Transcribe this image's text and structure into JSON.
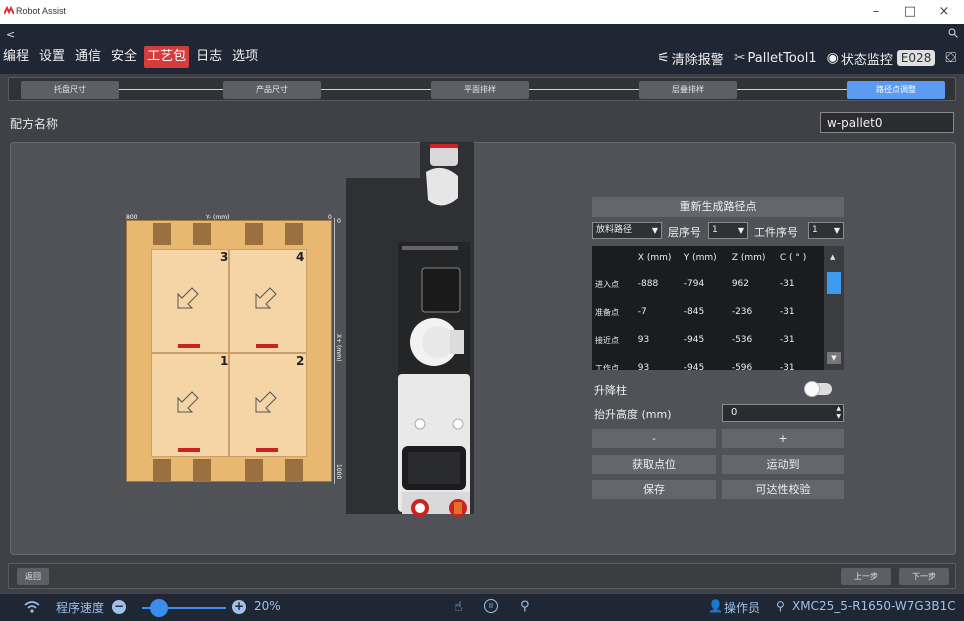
{
  "window": {
    "title": "Robot Assist",
    "minimize": "–",
    "maximize": "□",
    "close": "×"
  },
  "nav": {
    "back": "<",
    "search": "🔍",
    "menu": [
      "编程",
      "设置",
      "通信",
      "安全",
      "工艺包",
      "日志",
      "选项"
    ],
    "active_menu": "工艺包",
    "clear_alarm": "清除报警",
    "tool": "PalletTool1",
    "status_monitor": "状态监控",
    "error_code": "E028"
  },
  "steps": [
    "托盘尺寸",
    "产品尺寸",
    "平面排样",
    "层叠排样",
    "路径点调整"
  ],
  "recipe": {
    "label": "配方名称",
    "value": "w-pallet0"
  },
  "pallet": {
    "axis_top_left": "800",
    "axis_top_title": "Y- (mm)",
    "axis_top_right": "0",
    "axis_right_top": "0",
    "axis_right_title": "X+ (mm)",
    "axis_right_bottom": "1000",
    "cells": [
      "3",
      "4",
      "1",
      "2"
    ]
  },
  "panel": {
    "regenerate": "重新生成路径点",
    "path_select": "放料路径",
    "layer_label": "层序号",
    "layer_value": "1",
    "piece_label": "工件序号",
    "piece_value": "1",
    "table": {
      "headers": [
        "",
        "X (mm)",
        "Y (mm)",
        "Z (mm)",
        "C ( ° )"
      ],
      "rows": [
        [
          "进入点",
          "-888",
          "-794",
          "962",
          "-31"
        ],
        [
          "准备点",
          "-7",
          "-845",
          "-236",
          "-31"
        ],
        [
          "接近点",
          "93",
          "-945",
          "-536",
          "-31"
        ],
        [
          "工作点",
          "93",
          "-945",
          "-596",
          "-31"
        ]
      ]
    },
    "lift_label": "升降柱",
    "lift_height_label": "抬升高度 (mm)",
    "lift_height_value": "0",
    "minus": "-",
    "plus": "+",
    "get_point": "获取点位",
    "move_to": "运动到",
    "save": "保存",
    "reach_check": "可达性校验"
  },
  "bottom": {
    "back": "返回",
    "prev": "上一步",
    "next": "下一步"
  },
  "status": {
    "speed_label": "程序速度",
    "speed_value": "20%",
    "operator": "操作员",
    "device": "XMC25_5-R1650-W7G3B1C"
  }
}
